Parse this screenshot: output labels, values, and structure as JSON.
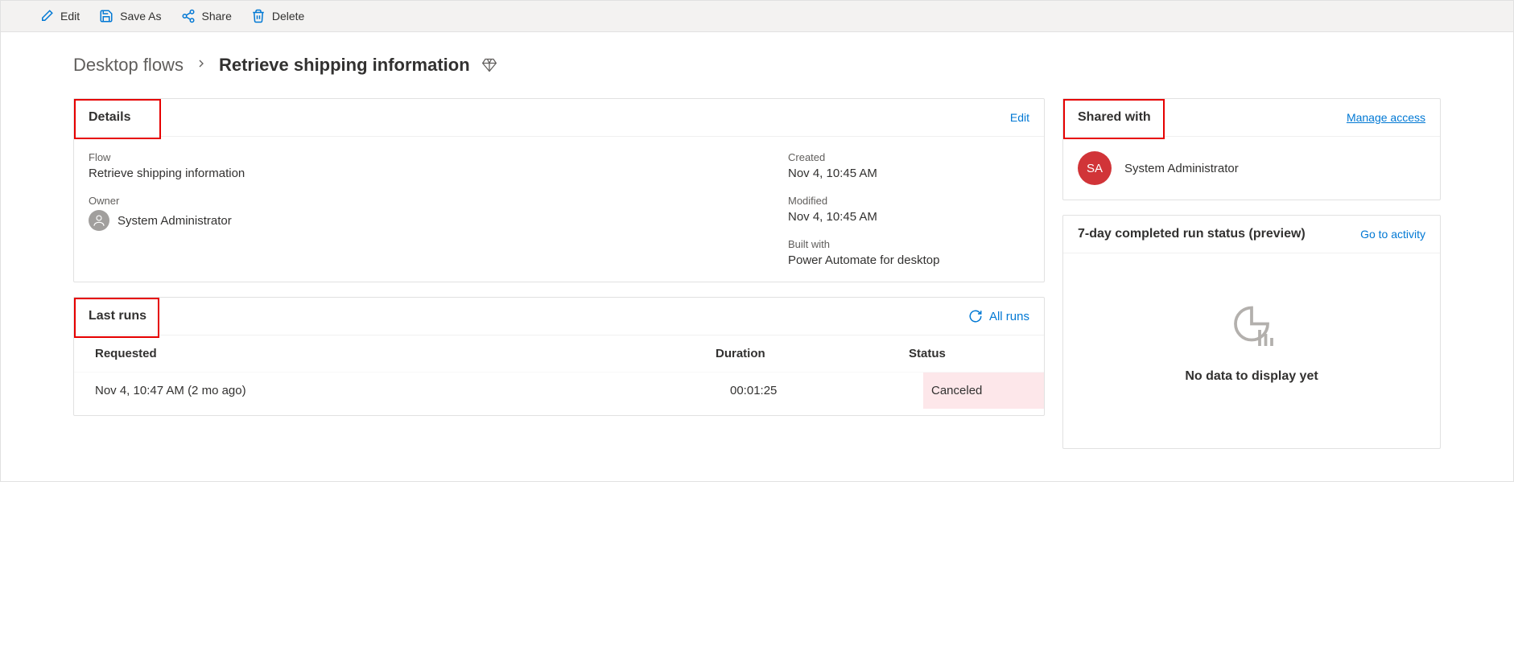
{
  "toolbar": {
    "edit": "Edit",
    "saveAs": "Save As",
    "share": "Share",
    "delete": "Delete"
  },
  "breadcrumb": {
    "parent": "Desktop flows",
    "current": "Retrieve shipping information"
  },
  "details": {
    "title": "Details",
    "editLink": "Edit",
    "flowLabel": "Flow",
    "flowName": "Retrieve shipping information",
    "ownerLabel": "Owner",
    "ownerName": "System Administrator",
    "createdLabel": "Created",
    "createdValue": "Nov 4, 10:45 AM",
    "modifiedLabel": "Modified",
    "modifiedValue": "Nov 4, 10:45 AM",
    "builtWithLabel": "Built with",
    "builtWithValue": "Power Automate for desktop"
  },
  "lastRuns": {
    "title": "Last runs",
    "allRunsLink": "All runs",
    "columns": {
      "requested": "Requested",
      "duration": "Duration",
      "status": "Status"
    },
    "row": {
      "requested": "Nov 4, 10:47 AM (2 mo ago)",
      "duration": "00:01:25",
      "status": "Canceled"
    }
  },
  "sharedWith": {
    "title": "Shared with",
    "manageLink": "Manage access",
    "avatarInitials": "SA",
    "name": "System Administrator"
  },
  "runStatus": {
    "title": "7-day completed run status (preview)",
    "activityLink": "Go to activity",
    "noData": "No data to display yet"
  }
}
